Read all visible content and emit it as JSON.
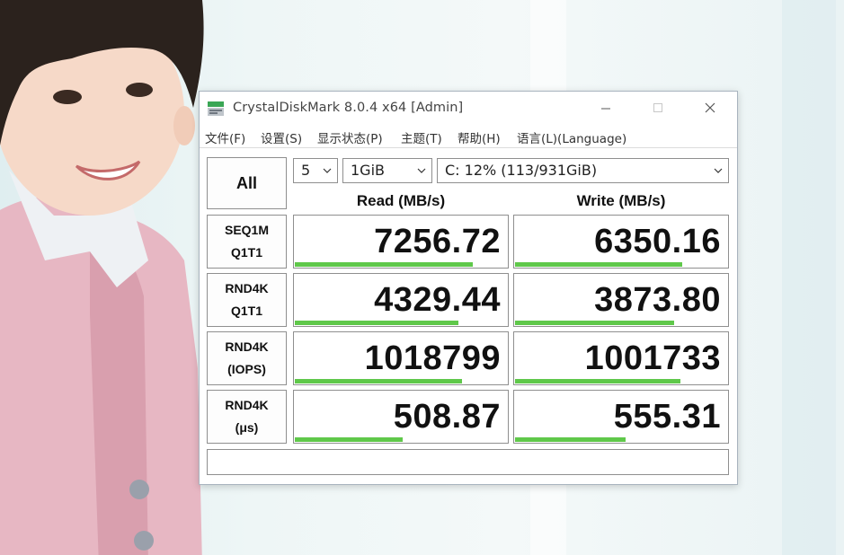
{
  "window": {
    "title": "CrystalDiskMark 8.0.4 x64 [Admin]"
  },
  "menu": [
    "文件(F)",
    "设置(S)",
    "显示状态(P)",
    "主题(T)",
    "帮助(H)",
    "语言(L)(Language)"
  ],
  "controls": {
    "all_label": "All",
    "count_value": "5",
    "size_value": "1GiB",
    "drive_value": "C: 12% (113/931GiB)"
  },
  "headers": {
    "read": "Read (MB/s)",
    "write": "Write (MB/s)"
  },
  "rows": [
    {
      "line1": "SEQ1M",
      "line2": "Q1T1",
      "read": "7256.72",
      "write": "6350.16",
      "read_fill": 0.84,
      "write_fill": 0.79
    },
    {
      "line1": "RND4K",
      "line2": "Q1T1",
      "read": "4329.44",
      "write": "3873.80",
      "read_fill": 0.77,
      "write_fill": 0.75
    },
    {
      "line1": "RND4K",
      "line2": "(IOPS)",
      "read": "1018799",
      "write": "1001733",
      "read_fill": 0.79,
      "write_fill": 0.78
    },
    {
      "line1": "RND4K",
      "line2": "(μs)",
      "read": "508.87",
      "write": "555.31",
      "read_fill": 0.51,
      "write_fill": 0.52
    }
  ],
  "comment": "",
  "colors": {
    "bar": "#5fc84a",
    "border": "#8f8f8f"
  },
  "icons": {
    "app": "crystaldiskmark-icon",
    "minimize": "minimize-icon",
    "maximize": "maximize-icon",
    "close": "close-icon",
    "dropdown": "chevron-down-icon"
  }
}
